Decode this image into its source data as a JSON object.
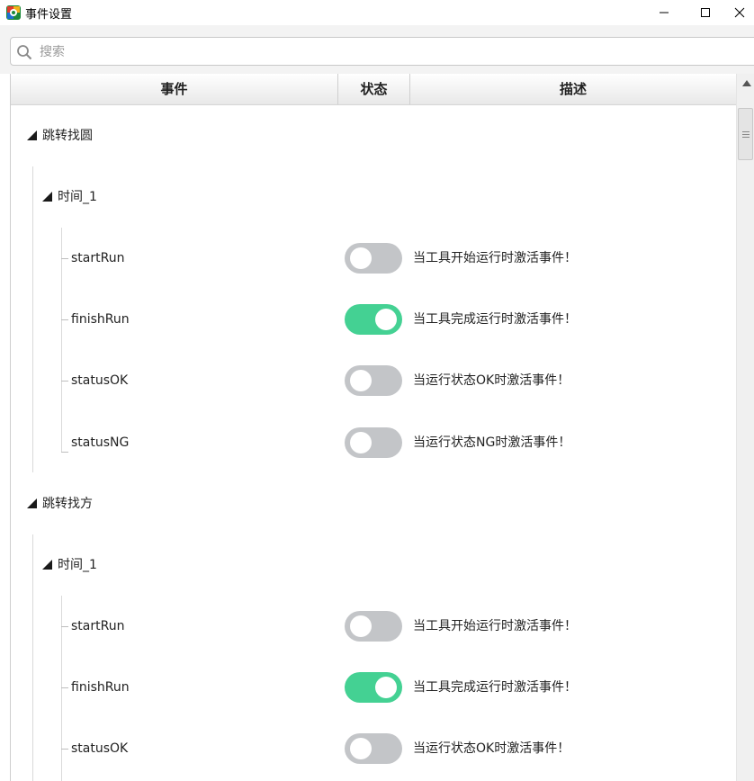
{
  "window": {
    "title": "事件设置",
    "controls": {
      "minimize": "minimize-icon",
      "maximize": "maximize-icon",
      "close": "close-icon"
    }
  },
  "search": {
    "placeholder": "搜索",
    "value": ""
  },
  "table": {
    "columns": {
      "event": "事件",
      "status": "状态",
      "desc": "描述"
    }
  },
  "colors": {
    "toggle_on": "#44d193",
    "toggle_off": "#c3c5c8",
    "accent": "#44d193"
  },
  "tree": [
    {
      "label": "跳转找圆",
      "children": [
        {
          "label": "时间_1",
          "events": [
            {
              "name": "startRun",
              "enabled": false,
              "desc": "当工具开始运行时激活事件！"
            },
            {
              "name": "finishRun",
              "enabled": true,
              "desc": "当工具完成运行时激活事件！"
            },
            {
              "name": "statusOK",
              "enabled": false,
              "desc": "当运行状态OK时激活事件！"
            },
            {
              "name": "statusNG",
              "enabled": false,
              "desc": "当运行状态NG时激活事件！"
            }
          ]
        }
      ]
    },
    {
      "label": "跳转找方",
      "children": [
        {
          "label": "时间_1",
          "events": [
            {
              "name": "startRun",
              "enabled": false,
              "desc": "当工具开始运行时激活事件！"
            },
            {
              "name": "finishRun",
              "enabled": true,
              "desc": "当工具完成运行时激活事件！"
            },
            {
              "name": "statusOK",
              "enabled": false,
              "desc": "当运行状态OK时激活事件！"
            }
          ]
        }
      ]
    }
  ]
}
